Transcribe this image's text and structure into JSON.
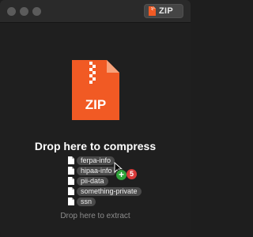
{
  "titlebar": {
    "format": {
      "label": "ZIP",
      "icon": "zip-file-icon"
    }
  },
  "main": {
    "big_icon": {
      "label": "ZIP",
      "icon": "zip-archive-icon",
      "color": "#f15a24"
    },
    "compress_label": "Drop here to compress",
    "files": [
      {
        "name": "ferpa-info",
        "icon": "document-icon"
      },
      {
        "name": "hipaa-info",
        "icon": "document-icon"
      },
      {
        "name": "pii-data",
        "icon": "document-icon"
      },
      {
        "name": "something-private",
        "icon": "document-icon"
      },
      {
        "name": "ssn",
        "icon": "document-icon"
      }
    ],
    "drag_count": "5",
    "extract_label": "Drop here to extract"
  },
  "colors": {
    "accent": "#f15a24",
    "add_badge": "#2fa33a",
    "count_badge": "#d93a3a"
  }
}
